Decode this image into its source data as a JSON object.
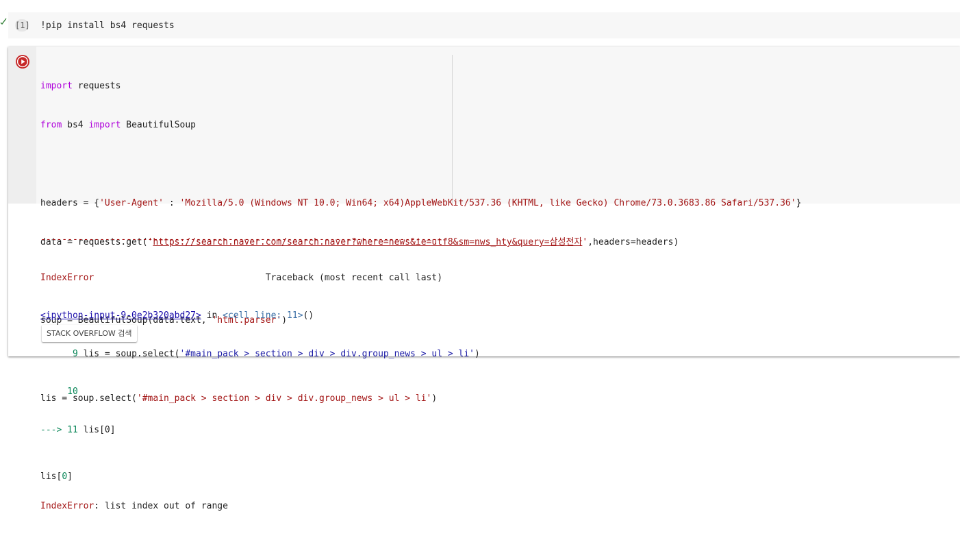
{
  "cell1": {
    "exec_count": "[1]",
    "code": "!pip install bs4 requests"
  },
  "cell2": {
    "lines": {
      "l1": {
        "kw": "import",
        "rest": " requests"
      },
      "l2": {
        "kw1": "from",
        "mid": " bs4 ",
        "kw2": "import",
        "rest": " BeautifulSoup"
      },
      "l4": {
        "prefix": "headers = {",
        "key": "'User-Agent'",
        "sep": " : ",
        "val": "'Mozilla/5.0 (Windows NT 10.0; Win64; x64)AppleWebKit/537.36 (KHTML, like Gecko) Chrome/73.0.3683.86 Safari/537.36'",
        "suffix": "}"
      },
      "l5": {
        "prefix": "data = requests.get(",
        "q1": "'",
        "url": "https://search.naver.com/search.naver?where=news&ie=utf8&sm=nws_hty&query=삼성전자",
        "q2": "'",
        "suffix": ",headers=headers)"
      },
      "l7": {
        "prefix": "soup = BeautifulSoup(data.text, ",
        "str": "'html.parser'",
        "suffix": ")"
      },
      "l9": {
        "prefix": "lis = soup.select(",
        "str": "'#main_pack > section > div > div.group_news > ul > li'",
        "suffix": ")"
      },
      "l11": {
        "prefix": "lis[",
        "num": "0",
        "suffix": "]"
      }
    },
    "output": {
      "dashes": "---------------------------------------------------------------------------",
      "error_type": "IndexError",
      "traceback_header": "                                Traceback (most recent call last)",
      "input_link": "<ipython-input-9-0e2b320abd27>",
      "in_text": " in ",
      "cell_ref": "<cell line: 11>",
      "call_parens": "()",
      "tb_line9_num": "      9",
      "tb_line9_prefix": " lis = soup.select(",
      "tb_line9_str": "'#main_pack > section > div > div.group_news > ul > li'",
      "tb_line9_suffix": ")",
      "tb_line10_num": "     10",
      "tb_arrow": "---> 11",
      "tb_line11_code": " lis[0]",
      "final_error_type": "IndexError",
      "final_error_msg": ": list index out of range"
    },
    "stack_overflow_label": "STACK OVERFLOW 검색"
  },
  "colors": {
    "run_button": "#c62828",
    "keyword": "#af00db",
    "string": "#a31515",
    "number": "#098658"
  }
}
